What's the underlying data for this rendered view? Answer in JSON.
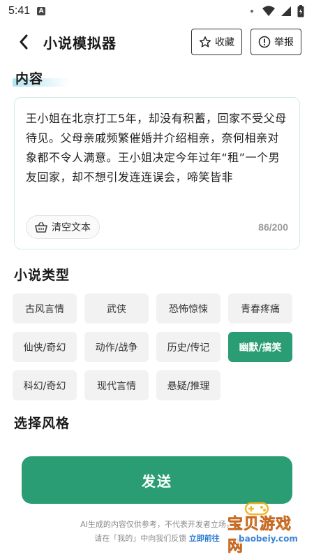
{
  "status_bar": {
    "time": "5:41",
    "app_indicator": "A"
  },
  "header": {
    "title": "小说模拟器",
    "favorite_label": "收藏",
    "report_label": "举报"
  },
  "content_section": {
    "title": "内容",
    "text": "王小姐在北京打工5年，却没有积蓄，回家不受父母待见。父母亲戚频繁催婚并介绍相亲，奈何相亲对象都不令人满意。王小姐决定今年过年“租”一个男友回家，却不想引发连连误会，啼笑皆非",
    "clear_label": "清空文本",
    "char_count": "86/200"
  },
  "genre_section": {
    "title": "小说类型",
    "genres": [
      "古风言情",
      "武侠",
      "恐怖惊悚",
      "青春疼痛",
      "仙侠/奇幻",
      "动作/战争",
      "历史/传记",
      "幽默/搞笑",
      "科幻/奇幻",
      "现代言情",
      "悬疑/推理"
    ],
    "selected": "幽默/搞笑"
  },
  "style_section": {
    "title": "选择风格"
  },
  "send_button": {
    "label": "发送"
  },
  "disclaimer": {
    "line1": "AI生成的内容仅供参考，不代表开发者立场，",
    "line2": "请在「我的」中向我们反馈",
    "link": "立即前往"
  },
  "watermark": {
    "text": "宝贝游戏网",
    "sub": "baobeiy.com"
  },
  "colors": {
    "accent": "#2a9d74",
    "link": "#2a7bd1",
    "chip_bg": "#f2f2f2"
  },
  "icons": {
    "back": "chevron-left-icon",
    "favorite": "star-outline-icon",
    "report": "info-circle-icon",
    "clear": "basket-icon"
  }
}
